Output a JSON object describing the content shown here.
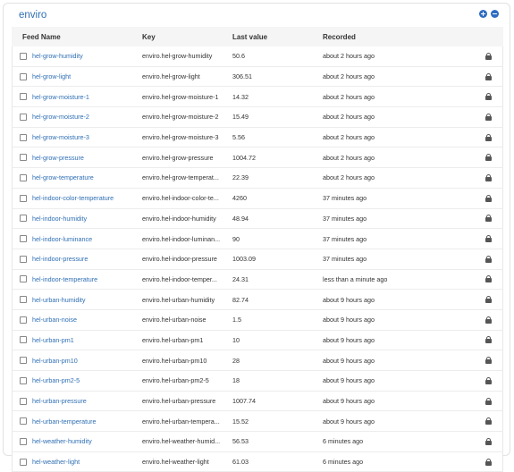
{
  "group": {
    "title": "enviro"
  },
  "columns": {
    "name": "Feed Name",
    "key": "Key",
    "value": "Last value",
    "recorded": "Recorded"
  },
  "feeds": [
    {
      "name": "hel-grow-humidity",
      "key": "enviro.hel-grow-humidity",
      "value": "50.6",
      "recorded": "about 2 hours ago"
    },
    {
      "name": "hel-grow-light",
      "key": "enviro.hel-grow-light",
      "value": "306.51",
      "recorded": "about 2 hours ago"
    },
    {
      "name": "hel-grow-moisture-1",
      "key": "enviro.hel-grow-moisture-1",
      "value": "14.32",
      "recorded": "about 2 hours ago"
    },
    {
      "name": "hel-grow-moisture-2",
      "key": "enviro.hel-grow-moisture-2",
      "value": "15.49",
      "recorded": "about 2 hours ago"
    },
    {
      "name": "hel-grow-moisture-3",
      "key": "enviro.hel-grow-moisture-3",
      "value": "5.56",
      "recorded": "about 2 hours ago"
    },
    {
      "name": "hel-grow-pressure",
      "key": "enviro.hel-grow-pressure",
      "value": "1004.72",
      "recorded": "about 2 hours ago"
    },
    {
      "name": "hel-grow-temperature",
      "key": "enviro.hel-grow-temperat...",
      "value": "22.39",
      "recorded": "about 2 hours ago"
    },
    {
      "name": "hel-indoor-color-temperature",
      "key": "enviro.hel-indoor-color-te...",
      "value": "4260",
      "recorded": "37 minutes ago"
    },
    {
      "name": "hel-indoor-humidity",
      "key": "enviro.hel-indoor-humidity",
      "value": "48.94",
      "recorded": "37 minutes ago"
    },
    {
      "name": "hel-indoor-luminance",
      "key": "enviro.hel-indoor-luminan...",
      "value": "90",
      "recorded": "37 minutes ago"
    },
    {
      "name": "hel-indoor-pressure",
      "key": "enviro.hel-indoor-pressure",
      "value": "1003.09",
      "recorded": "37 minutes ago"
    },
    {
      "name": "hel-indoor-temperature",
      "key": "enviro.hel-indoor-temper...",
      "value": "24.31",
      "recorded": "less than a minute ago"
    },
    {
      "name": "hel-urban-humidity",
      "key": "enviro.hel-urban-humidity",
      "value": "82.74",
      "recorded": "about 9 hours ago"
    },
    {
      "name": "hel-urban-noise",
      "key": "enviro.hel-urban-noise",
      "value": "1.5",
      "recorded": "about 9 hours ago"
    },
    {
      "name": "hel-urban-pm1",
      "key": "enviro.hel-urban-pm1",
      "value": "10",
      "recorded": "about 9 hours ago"
    },
    {
      "name": "hel-urban-pm10",
      "key": "enviro.hel-urban-pm10",
      "value": "28",
      "recorded": "about 9 hours ago"
    },
    {
      "name": "hel-urban-pm2-5",
      "key": "enviro.hel-urban-pm2-5",
      "value": "18",
      "recorded": "about 9 hours ago"
    },
    {
      "name": "hel-urban-pressure",
      "key": "enviro.hel-urban-pressure",
      "value": "1007.74",
      "recorded": "about 9 hours ago"
    },
    {
      "name": "hel-urban-temperature",
      "key": "enviro.hel-urban-tempera...",
      "value": "15.52",
      "recorded": "about 9 hours ago"
    },
    {
      "name": "hel-weather-humidity",
      "key": "enviro.hel-weather-humid...",
      "value": "56.53",
      "recorded": "6 minutes ago"
    },
    {
      "name": "hel-weather-light",
      "key": "enviro.hel-weather-light",
      "value": "61.03",
      "recorded": "6 minutes ago"
    }
  ],
  "icons": {
    "add": "plus-circle-icon",
    "remove": "minus-circle-icon",
    "lock": "lock-icon"
  },
  "colors": {
    "link": "#2f6fb5",
    "button": "#2d6cc0"
  }
}
